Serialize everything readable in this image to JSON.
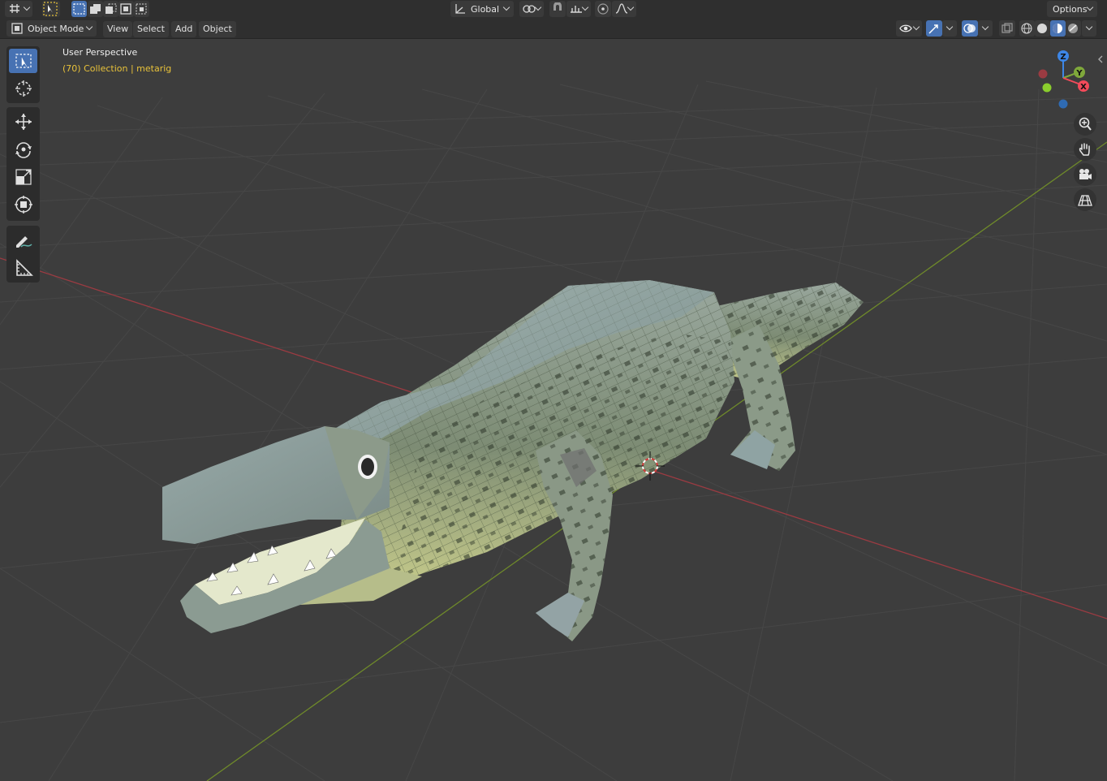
{
  "header": {
    "orientation": "Global",
    "options_label": "Options",
    "mode": "Object Mode",
    "menus": [
      "View",
      "Select",
      "Add",
      "Object"
    ]
  },
  "viewport": {
    "view_name": "User Perspective",
    "collection_info": "(70) Collection | metarig",
    "info_color": "#e8c23a"
  },
  "gizmo": {
    "z_label": "Z",
    "y_label": "Y",
    "x_label": "X",
    "x_color": "#f34a5a",
    "y_color": "#7fa83b",
    "z_color": "#3d86e6"
  },
  "tools": [
    "select-box",
    "cursor",
    "move",
    "rotate",
    "scale",
    "transform",
    "annotate",
    "measure"
  ],
  "nav_buttons": [
    "zoom-icon",
    "hand-pan-icon",
    "camera-icon",
    "grid-ortho-icon"
  ],
  "colors": {
    "accent": "#4772b3",
    "x_axis": "#9b3b42",
    "y_axis": "#6f8a2a"
  }
}
